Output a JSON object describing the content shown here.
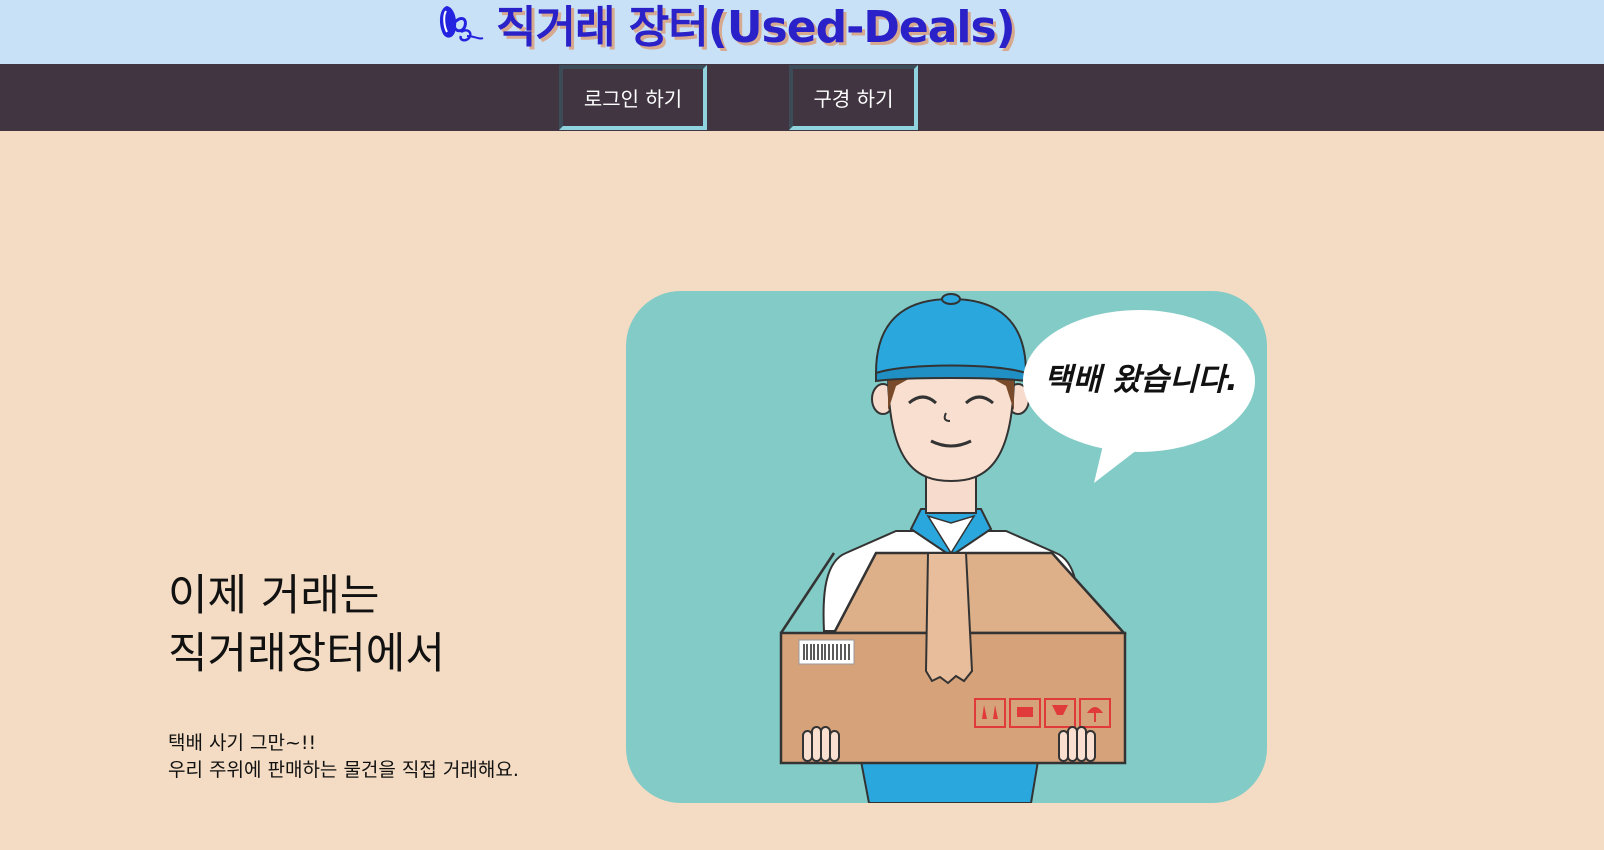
{
  "header": {
    "logo_icon": "butterfly-logo-icon",
    "title": "직거래 장터(Used-Deals)",
    "title_color": "#2a22c8",
    "background": "#c9e1f6"
  },
  "nav": {
    "login_label": "로그인 하기",
    "browse_label": "구경 하기",
    "background": "#403541"
  },
  "hero": {
    "headline_line1": "이제 거래는",
    "headline_line2": "직거래장터에서",
    "sub_line1": "택배 사기 그만~!!",
    "sub_line2": "우리 주위에 판매하는 물건을 직접 거래해요.",
    "speech_bubble": "택배 왔습니다.",
    "image_icon": "delivery-man-illustration"
  },
  "page_background": "#f3dcc3"
}
